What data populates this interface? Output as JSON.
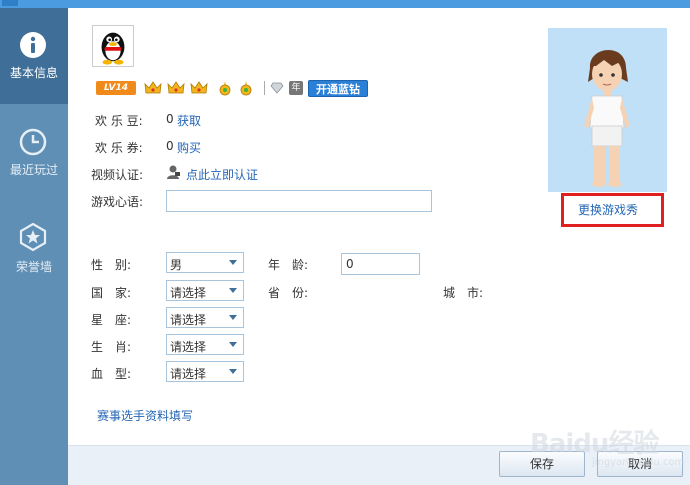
{
  "sidebar": {
    "items": [
      {
        "label": "基本信息",
        "icon": "info-icon",
        "active": true
      },
      {
        "label": "最近玩过",
        "icon": "clock-icon",
        "active": false
      },
      {
        "label": "荣誉墙",
        "icon": "star-shield-icon",
        "active": false
      }
    ]
  },
  "profile": {
    "avatar_icon": "qq-penguin-avatar",
    "level_badge": "LV14",
    "year_badge": "年",
    "open_blue_diamond": "开通蓝钻"
  },
  "info": {
    "happy_beans_label": "欢 乐 豆:",
    "happy_beans_value": "0",
    "happy_beans_link": "获取",
    "happy_coupons_label": "欢 乐 券:",
    "happy_coupons_value": "0",
    "happy_coupons_link": "购买",
    "video_verify_label": "视频认证:",
    "video_verify_link": "点此立即认证",
    "game_motto_label": "游戏心语:",
    "game_motto_value": ""
  },
  "form": {
    "gender_label": "性　别:",
    "gender_value": "男",
    "age_label": "年　龄:",
    "age_value": "0",
    "country_label": "国　家:",
    "country_value": "请选择",
    "province_label": "省　份:",
    "city_label": "城　市:",
    "zodiac_label": "星　座:",
    "zodiac_value": "请选择",
    "chinese_zodiac_label": "生　肖:",
    "chinese_zodiac_value": "请选择",
    "blood_type_label": "血　型:",
    "blood_type_value": "请选择",
    "contestant_link": "赛事选手资料填写"
  },
  "game_show": {
    "change_link": "更换游戏秀"
  },
  "footer": {
    "save_label": "保存",
    "cancel_label": "取消"
  },
  "watermark": {
    "text": "Baidu经验",
    "url": "jingyan.baidu.com"
  },
  "colors": {
    "sidebar_bg": "#5f8fb5",
    "sidebar_active": "#3f6f98",
    "link": "#2466b5",
    "highlight_box": "#e02020",
    "show_panel_bg": "#bfe0f6"
  }
}
